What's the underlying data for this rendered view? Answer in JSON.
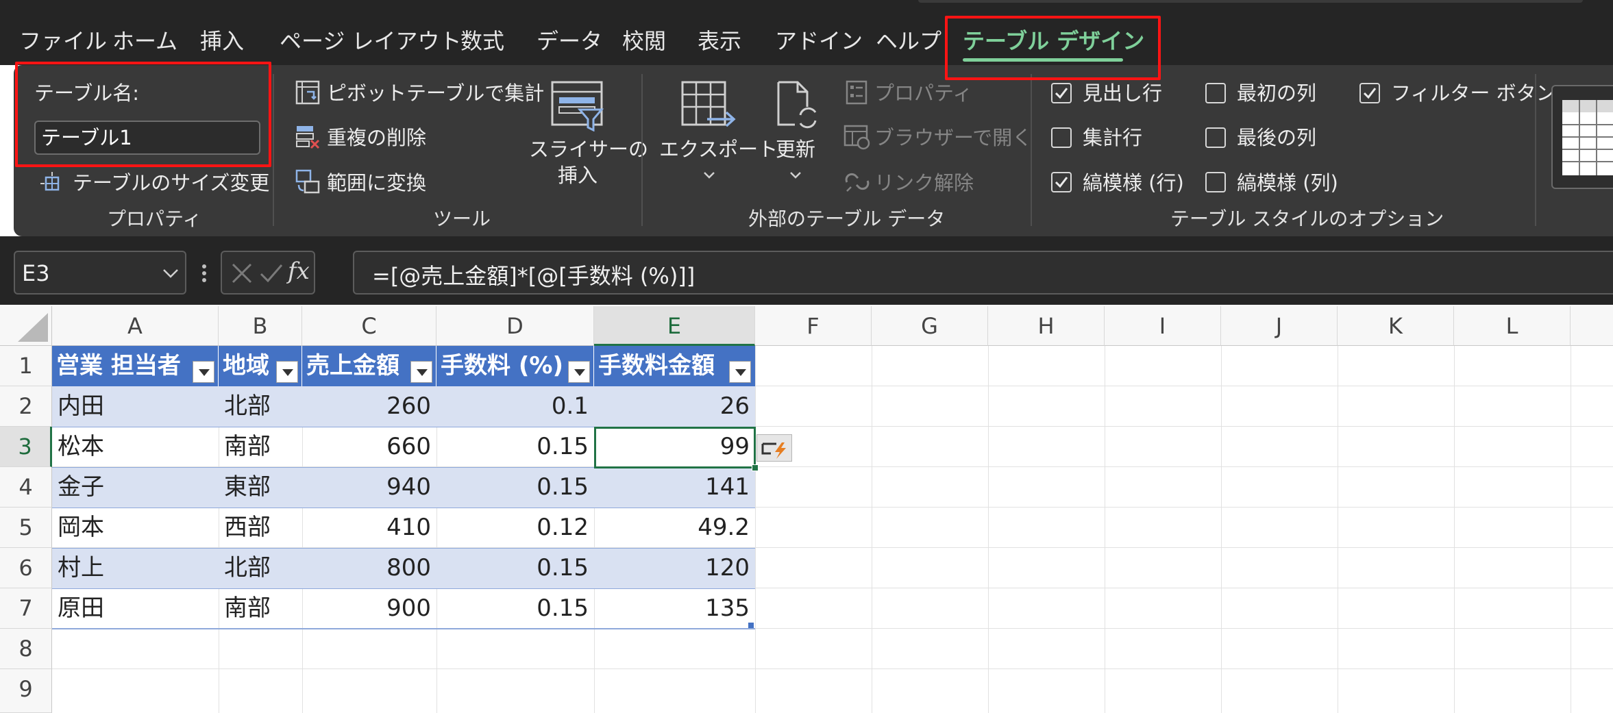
{
  "menu": {
    "tabs": [
      "ファイル",
      "ホーム",
      "挿入",
      "ページ レイアウト",
      "数式",
      "データ",
      "校閲",
      "表示",
      "アドイン",
      "ヘルプ"
    ],
    "active_tab": "テーブル デザイン"
  },
  "ribbon": {
    "properties": {
      "name_label": "テーブル名:",
      "name_value": "テーブル1",
      "resize_label": "テーブルのサイズ変更",
      "group_label": "プロパティ"
    },
    "tools": {
      "pivot_label": "ピボットテーブルで集計",
      "remove_dup_label": "重複の削除",
      "convert_label": "範囲に変換",
      "slicer_line1": "スライサーの",
      "slicer_line2": "挿入",
      "group_label": "ツール"
    },
    "external": {
      "export_label": "エクスポート",
      "refresh_label": "更新",
      "properties_label": "プロパティ",
      "browser_label": "ブラウザーで開く",
      "unlink_label": "リンク解除",
      "group_label": "外部のテーブル データ"
    },
    "style_options": {
      "header_row": {
        "label": "見出し行",
        "checked": true
      },
      "total_row": {
        "label": "集計行",
        "checked": false
      },
      "banded_rows": {
        "label": "縞模様 (行)",
        "checked": true
      },
      "first_column": {
        "label": "最初の列",
        "checked": false
      },
      "last_column": {
        "label": "最後の列",
        "checked": false
      },
      "banded_columns": {
        "label": "縞模様 (列)",
        "checked": false
      },
      "filter_button": {
        "label": "フィルター ボタン",
        "checked": true
      },
      "group_label": "テーブル スタイルのオプション"
    }
  },
  "formula_bar": {
    "name_box": "E3",
    "fx_label": "fx",
    "formula": "=[@売上金額]*[@[手数料 (%)]]"
  },
  "sheet": {
    "columns": [
      "A",
      "B",
      "C",
      "D",
      "E",
      "F",
      "G",
      "H",
      "I",
      "J",
      "K",
      "L"
    ],
    "rows": [
      "1",
      "2",
      "3",
      "4",
      "5",
      "6",
      "7",
      "8",
      "9"
    ],
    "selected_cell": "E3",
    "table_headers": [
      "営業 担当者",
      "地域",
      "売上金額",
      "手数料 (%)",
      "手数料金額"
    ],
    "table_rows": [
      [
        "内田",
        "北部",
        "260",
        "0.1",
        "26"
      ],
      [
        "松本",
        "南部",
        "660",
        "0.15",
        "99"
      ],
      [
        "金子",
        "東部",
        "940",
        "0.15",
        "141"
      ],
      [
        "岡本",
        "西部",
        "410",
        "0.12",
        "49.2"
      ],
      [
        "村上",
        "北部",
        "800",
        "0.15",
        "120"
      ],
      [
        "原田",
        "南部",
        "900",
        "0.15",
        "135"
      ]
    ],
    "colors": {
      "header_fill": "#4472c4",
      "band_fill": "#d9e1f2",
      "selection": "#217346"
    }
  }
}
